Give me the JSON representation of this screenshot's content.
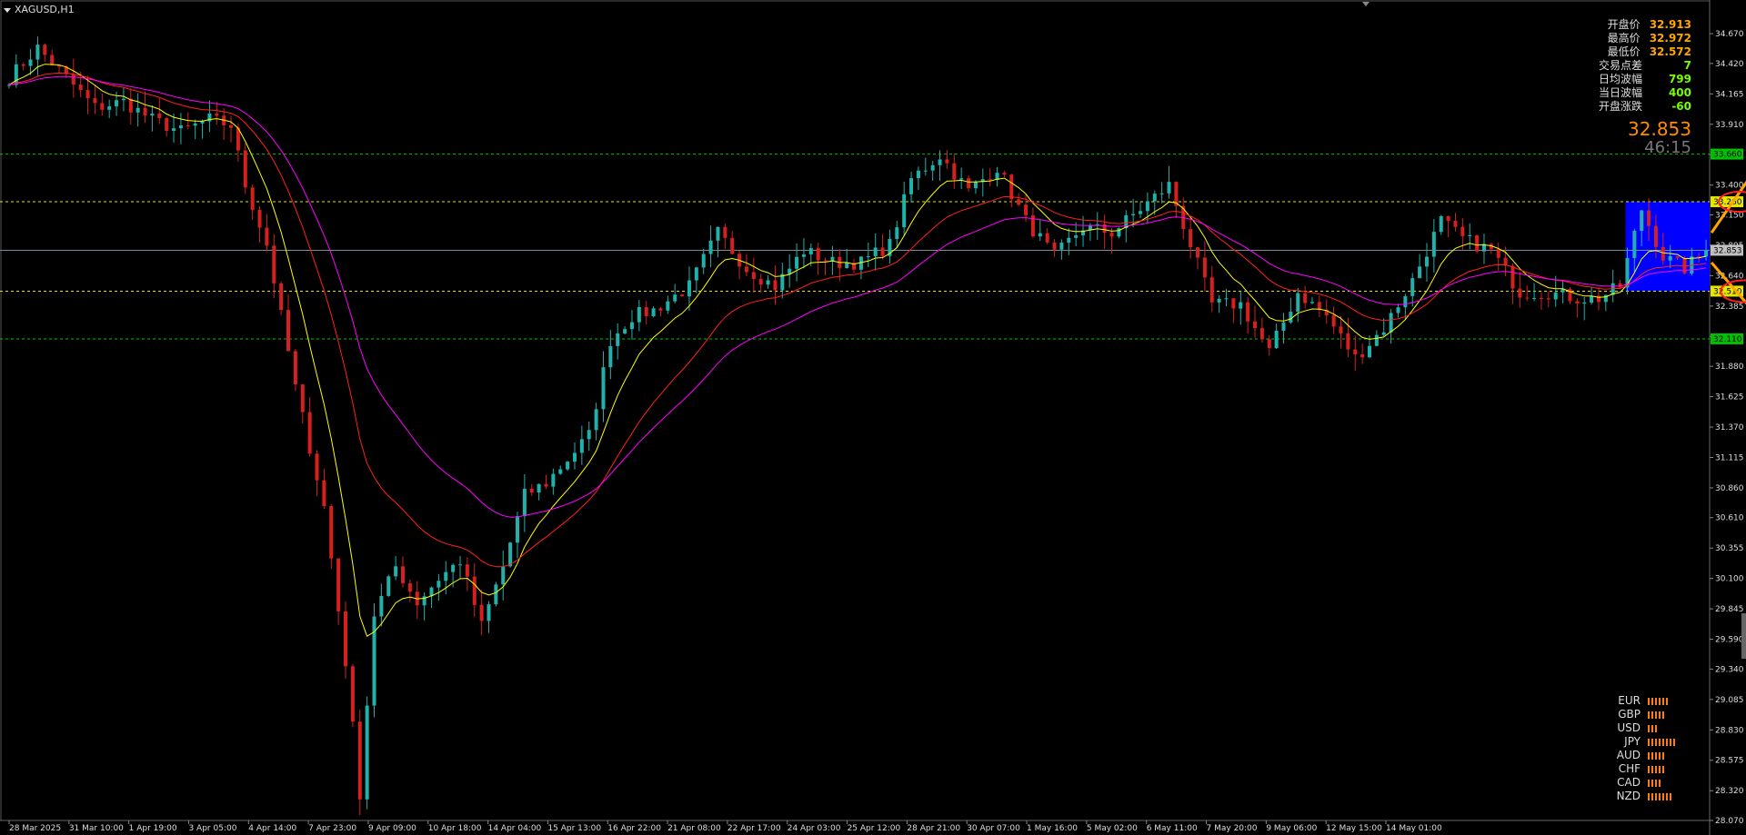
{
  "window": {
    "symbol_label": "XAGUSD,H1"
  },
  "info_panel": [
    {
      "label": "开盘价",
      "value": "32.913",
      "color": "#ffa500"
    },
    {
      "label": "最高价",
      "value": "32.972",
      "color": "#ffa500"
    },
    {
      "label": "最低价",
      "value": "32.572",
      "color": "#ffa500"
    },
    {
      "label": "交易点差",
      "value": "7",
      "color": "#7cfc00"
    },
    {
      "label": "日均波幅",
      "value": "799",
      "color": "#7cfc00"
    },
    {
      "label": "当日波幅",
      "value": "400",
      "color": "#7cfc00"
    },
    {
      "label": "开盘涨跌",
      "value": "-60",
      "color": "#7cfc00"
    }
  ],
  "current_price": "32.853",
  "countdown": "46:15",
  "currency_strength": [
    {
      "name": "EUR",
      "bars": 6
    },
    {
      "name": "GBP",
      "bars": 5
    },
    {
      "name": "USD",
      "bars": 3
    },
    {
      "name": "JPY",
      "bars": 8
    },
    {
      "name": "AUD",
      "bars": 5
    },
    {
      "name": "CHF",
      "bars": 5
    },
    {
      "name": "CAD",
      "bars": 4
    },
    {
      "name": "NZD",
      "bars": 7
    }
  ],
  "colors": {
    "background": "#000000",
    "grid_text": "#dddddd",
    "bull_candle": "#20b2aa",
    "bear_candle": "#d62020",
    "ma_fast": "#ffff00",
    "ma_mid": "#ff2020",
    "ma_slow": "#ff00ff",
    "level_green": "#00c000",
    "level_yellow": "#e6e600",
    "range_box": "#0000ff",
    "arrow": "#ffa500",
    "ellipse": "#ff2020"
  },
  "chart_data": {
    "type": "candlestick",
    "symbol": "XAGUSD",
    "timeframe": "H1",
    "y_range": [
      28.07,
      34.8
    ],
    "y_ticks": [
      "34.670",
      "34.420",
      "34.165",
      "33.910",
      "33.655",
      "33.400",
      "33.150",
      "32.895",
      "32.640",
      "32.385",
      "32.130",
      "31.880",
      "31.625",
      "31.370",
      "31.115",
      "30.860",
      "30.610",
      "30.355",
      "30.100",
      "29.845",
      "29.590",
      "29.340",
      "29.085",
      "28.830",
      "28.575",
      "28.320",
      "28.070"
    ],
    "x_ticks": [
      "28 Mar 2025",
      "31 Mar 10:00",
      "1 Apr 19:00",
      "3 Apr 05:00",
      "4 Apr 14:00",
      "7 Apr 23:00",
      "9 Apr 09:00",
      "10 Apr 18:00",
      "14 Apr 04:00",
      "15 Apr 13:00",
      "16 Apr 22:00",
      "21 Apr 08:00",
      "22 Apr 17:00",
      "24 Apr 03:00",
      "25 Apr 12:00",
      "28 Apr 21:00",
      "30 Apr 07:00",
      "1 May 16:00",
      "5 May 02:00",
      "6 May 11:00",
      "7 May 20:00",
      "9 May 06:00",
      "12 May 15:00",
      "14 May 01:00"
    ],
    "levels": [
      {
        "value": 33.66,
        "label": "33.660",
        "color": "green"
      },
      {
        "value": 33.26,
        "label": "33.260",
        "color": "yellow"
      },
      {
        "value": 32.853,
        "label": "32.853",
        "color": "gray"
      },
      {
        "value": 32.51,
        "label": "32.510",
        "color": "yellow"
      },
      {
        "value": 32.11,
        "label": "32.110",
        "color": "green"
      }
    ],
    "range_box": {
      "from_index": 226,
      "high": 33.26,
      "low": 32.51
    },
    "anchors": [
      [
        0,
        34.3
      ],
      [
        4,
        34.55
      ],
      [
        8,
        34.3
      ],
      [
        12,
        34.05
      ],
      [
        16,
        34.1
      ],
      [
        20,
        33.95
      ],
      [
        24,
        33.85
      ],
      [
        28,
        33.95
      ],
      [
        31,
        33.9
      ],
      [
        33,
        33.4
      ],
      [
        36,
        32.9
      ],
      [
        40,
        31.7
      ],
      [
        44,
        30.7
      ],
      [
        47,
        29.4
      ],
      [
        49,
        28.3
      ],
      [
        51,
        29.8
      ],
      [
        54,
        30.2
      ],
      [
        57,
        29.9
      ],
      [
        60,
        30.1
      ],
      [
        63,
        30.25
      ],
      [
        66,
        29.7
      ],
      [
        69,
        30.2
      ],
      [
        72,
        30.8
      ],
      [
        75,
        30.9
      ],
      [
        78,
        31.1
      ],
      [
        81,
        31.3
      ],
      [
        84,
        32.1
      ],
      [
        87,
        32.3
      ],
      [
        90,
        32.35
      ],
      [
        95,
        32.55
      ],
      [
        99,
        33.0
      ],
      [
        103,
        32.7
      ],
      [
        107,
        32.55
      ],
      [
        111,
        32.85
      ],
      [
        115,
        32.75
      ],
      [
        119,
        32.75
      ],
      [
        123,
        32.9
      ],
      [
        126,
        33.45
      ],
      [
        130,
        33.65
      ],
      [
        134,
        33.35
      ],
      [
        138,
        33.55
      ],
      [
        142,
        33.1
      ],
      [
        146,
        32.8
      ],
      [
        150,
        33.05
      ],
      [
        154,
        33.0
      ],
      [
        158,
        33.2
      ],
      [
        162,
        33.4
      ],
      [
        165,
        32.9
      ],
      [
        168,
        32.4
      ],
      [
        172,
        32.4
      ],
      [
        176,
        32.0
      ],
      [
        180,
        32.5
      ],
      [
        184,
        32.3
      ],
      [
        188,
        31.95
      ],
      [
        192,
        32.2
      ],
      [
        196,
        32.6
      ],
      [
        200,
        33.1
      ],
      [
        203,
        32.95
      ],
      [
        207,
        32.85
      ],
      [
        211,
        32.5
      ],
      [
        215,
        32.5
      ],
      [
        219,
        32.45
      ],
      [
        222,
        32.45
      ],
      [
        225,
        32.55
      ],
      [
        228,
        33.2
      ],
      [
        231,
        32.8
      ],
      [
        234,
        32.7
      ],
      [
        237,
        32.85
      ]
    ],
    "candle_count": 238,
    "moving_averages": [
      {
        "color": "yellow",
        "period_hint": "fast"
      },
      {
        "color": "red",
        "period_hint": "medium"
      },
      {
        "color": "magenta",
        "period_hint": "slow"
      }
    ]
  }
}
